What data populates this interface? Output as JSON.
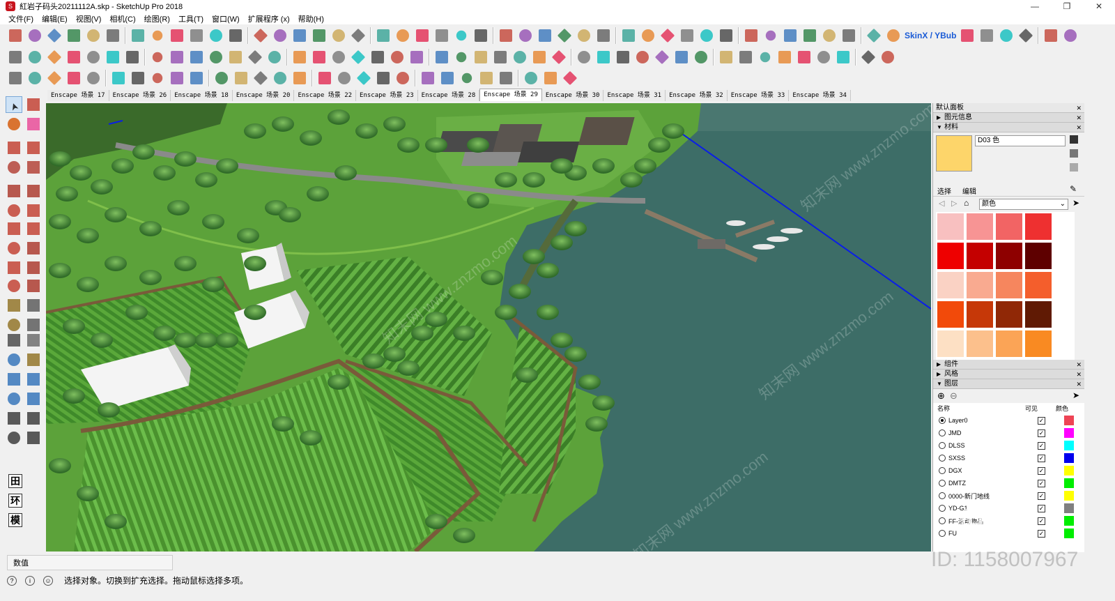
{
  "window": {
    "title": "紅岩子码头20211112A.skp - SketchUp Pro 2018",
    "buttons": [
      "—",
      "❐",
      "✕"
    ]
  },
  "menu": [
    "文件(F)",
    "编辑(E)",
    "视图(V)",
    "相机(C)",
    "绘图(R)",
    "工具(T)",
    "窗口(W)",
    "扩展程序 (x)",
    "帮助(H)"
  ],
  "toolbar": {
    "skinx_label": "SkinX / YBub"
  },
  "scene_tabs": [
    "Enscape 场景 17",
    "Enscape 场景 26",
    "Enscape 场景 18",
    "Enscape 场景 20",
    "Enscape 场景 22",
    "Enscape 场景 23",
    "Enscape 场景 28",
    "Enscape 场景 29",
    "Enscape 场景 30",
    "Enscape 场景 31",
    "Enscape 场景 32",
    "Enscape 场景 33",
    "Enscape 场景 34"
  ],
  "active_tab": "Enscape 场景 29",
  "left_big_buttons": [
    "田",
    "环",
    "模"
  ],
  "panel": {
    "title": "默认面板",
    "sections": {
      "entity_info": "图元信息",
      "materials": "材料",
      "components": "组件",
      "styles": "风格",
      "layers": "图层"
    },
    "material_name": "D03 色",
    "material_color": "#fdd56a",
    "tab_select": "选择",
    "tab_edit": "编辑",
    "library": "颜色",
    "swatches": [
      "#f8c0c0",
      "#f79494",
      "#f26464",
      "#ee3030",
      "#ee0000",
      "#c40000",
      "#8e0000",
      "#5e0000",
      "#fad2c4",
      "#f9aa90",
      "#f6865e",
      "#f45e2c",
      "#f24a0a",
      "#c63808",
      "#902806",
      "#601a04",
      "#fde0c4",
      "#fcc08c",
      "#fba456",
      "#f98a22",
      "#f07000",
      "#c45c00",
      "#904200",
      "#5e2c00"
    ],
    "layers_header": {
      "name": "名称",
      "visible": "可见",
      "color": "颜色"
    },
    "layers": [
      {
        "name": "Layer0",
        "active": true,
        "color": "#ee4455"
      },
      {
        "name": "JMD",
        "active": false,
        "color": "#ff00ff"
      },
      {
        "name": "DLSS",
        "active": false,
        "color": "#00ffff"
      },
      {
        "name": "SXSS",
        "active": false,
        "color": "#0000ee"
      },
      {
        "name": "DGX",
        "active": false,
        "color": "#ffff00"
      },
      {
        "name": "DMTZ",
        "active": false,
        "color": "#00ee00"
      },
      {
        "name": "0000-新门地线",
        "active": false,
        "color": "#ffff00"
      },
      {
        "name": "YD-G1",
        "active": false,
        "color": "#808080"
      },
      {
        "name": "FF-活动物品",
        "active": false,
        "color": "#00ee00"
      },
      {
        "name": "FU",
        "active": false,
        "color": "#00ee00"
      }
    ]
  },
  "status": {
    "measure_label": "数值",
    "hint": "选择对象。切换到扩充选择。拖动鼠标选择多项。"
  },
  "watermark": {
    "text": "知末网 www.znzmo.com",
    "logo": "知末",
    "id": "ID: 1158007967"
  }
}
